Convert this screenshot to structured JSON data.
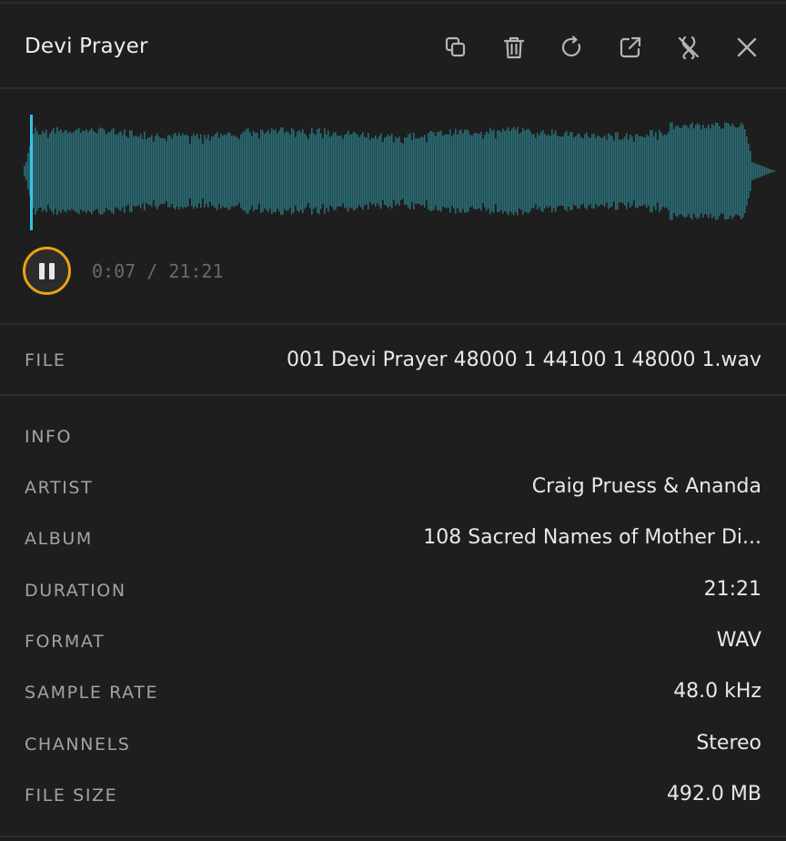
{
  "header": {
    "title": "Devi Prayer",
    "icons": [
      "copy-icon",
      "trash-icon",
      "refresh-icon",
      "external-link-icon",
      "unlink-icon",
      "close-icon"
    ]
  },
  "player": {
    "current_time": "0:07",
    "separator": "/",
    "duration": "21:21",
    "progress": 0.005,
    "state": "playing",
    "wave_color": "#2a6c74",
    "cursor_color": "#37c3e0",
    "accent_color": "#e8a311"
  },
  "file": {
    "label": "FILE",
    "value": "001 Devi Prayer 48000 1 44100 1 48000 1.wav"
  },
  "info": {
    "heading": "INFO",
    "rows": [
      {
        "label": "ARTIST",
        "value": "Craig Pruess & Ananda"
      },
      {
        "label": "ALBUM",
        "value": "108 Sacred Names of Mother Di..."
      },
      {
        "label": "DURATION",
        "value": "21:21"
      },
      {
        "label": "FORMAT",
        "value": "WAV"
      },
      {
        "label": "SAMPLE RATE",
        "value": "48.0 kHz"
      },
      {
        "label": "CHANNELS",
        "value": "Stereo"
      },
      {
        "label": "FILE SIZE",
        "value": "492.0 MB"
      }
    ]
  }
}
